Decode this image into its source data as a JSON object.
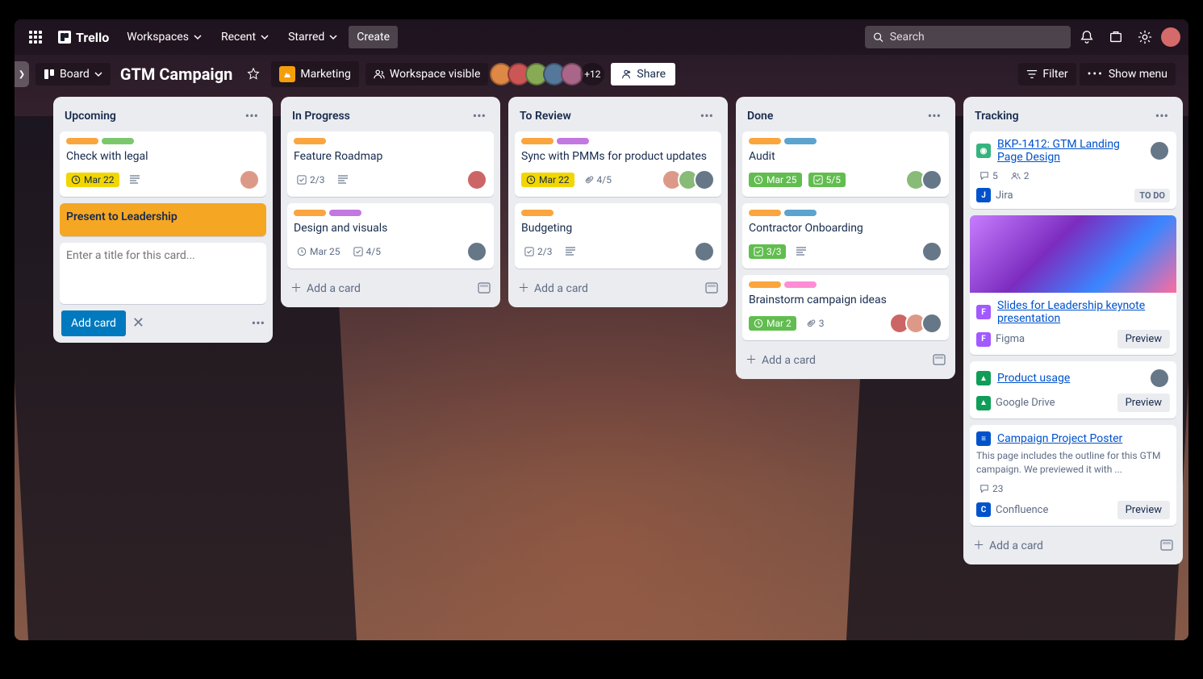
{
  "nav": {
    "brand": "Trello",
    "items": [
      "Workspaces",
      "Recent",
      "Starred"
    ],
    "create": "Create",
    "search_placeholder": "Search"
  },
  "boardbar": {
    "view_switch": "Board",
    "title": "GTM Campaign",
    "workspace_label": "Marketing",
    "visibility": "Workspace visible",
    "more_members": "+12",
    "share": "Share",
    "filter": "Filter",
    "show_menu": "Show menu"
  },
  "lists": {
    "upcoming": {
      "title": "Upcoming",
      "card1": {
        "title": "Check with legal",
        "due": "Mar 22"
      },
      "card2": {
        "title": "Present to Leadership"
      },
      "compose_placeholder": "Enter a title for this card...",
      "add_button": "Add card"
    },
    "in_progress": {
      "title": "In Progress",
      "card1": {
        "title": "Feature Roadmap",
        "checklist": "2/3"
      },
      "card2": {
        "title": "Design and visuals",
        "due": "Mar 25",
        "checklist": "4/5"
      },
      "add": "Add a card"
    },
    "to_review": {
      "title": "To Review",
      "card1": {
        "title": "Sync with PMMs for product updates",
        "due": "Mar 22",
        "attachments": "4/5"
      },
      "card2": {
        "title": "Budgeting",
        "checklist": "2/3"
      },
      "add": "Add a card"
    },
    "done": {
      "title": "Done",
      "card1": {
        "title": "Audit",
        "due": "Mar 25",
        "checklist": "5/5"
      },
      "card2": {
        "title": "Contractor Onboarding",
        "checklist": "3/3"
      },
      "card3": {
        "title": "Brainstorm campaign ideas",
        "due": "Mar 2",
        "attachments": "3"
      },
      "add": "Add a card"
    },
    "tracking": {
      "title": "Tracking",
      "card1": {
        "title": "BKP-1412: GTM Landing Page Design",
        "comments": "5",
        "members": "2",
        "source": "Jira",
        "status": "TO DO"
      },
      "card2": {
        "title": "Slides for Leadership keynote presentation",
        "source": "Figma",
        "preview": "Preview"
      },
      "card3": {
        "title": "Product usage",
        "source": "Google Drive",
        "preview": "Preview"
      },
      "card4": {
        "title": "Campaign Project Poster",
        "desc": "This page includes the outline for this GTM campaign. We previewed it with ...",
        "comments": "23",
        "source": "Confluence",
        "preview": "Preview"
      },
      "add": "Add a card"
    }
  }
}
